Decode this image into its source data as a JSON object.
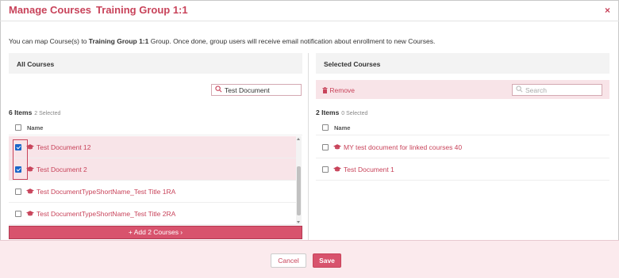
{
  "header": {
    "title_main": "Manage Courses",
    "title_group": "Training Group 1:1",
    "close": "×"
  },
  "intro": {
    "pre": "You can map Course(s) to ",
    "group": "Training Group 1:1",
    "post": " Group. Once done, group users will receive email notification about enrollment to new Courses."
  },
  "left": {
    "heading": "All Courses",
    "search_value": "Test Document",
    "count": "6 Items",
    "selected": "2 Selected",
    "column": "Name",
    "rows": [
      {
        "label": "Test Document 12",
        "checked": true
      },
      {
        "label": "Test Document 2",
        "checked": true
      },
      {
        "label": "Test DocumentTypeShortName_Test Title 1RA",
        "checked": false
      },
      {
        "label": "Test DocumentTypeShortName_Test Title 2RA",
        "checked": false
      }
    ],
    "add_button": "+ Add 2 Courses ›"
  },
  "right": {
    "heading": "Selected Courses",
    "remove": "Remove",
    "search_placeholder": "Search",
    "count": "2 Items",
    "selected": "0 Selected",
    "column": "Name",
    "rows": [
      {
        "label": "MY test document for linked courses 40"
      },
      {
        "label": "Test Document 1"
      }
    ]
  },
  "footer": {
    "cancel": "Cancel",
    "save": "Save"
  },
  "colors": {
    "accent": "#c8435a",
    "button": "#d8536d",
    "selected_row": "#f8e4e8",
    "checkbox": "#1a66c9"
  },
  "icons": {
    "course": "graduation-cap-icon",
    "search": "search-icon",
    "remove": "trash-icon",
    "close": "close-icon"
  }
}
